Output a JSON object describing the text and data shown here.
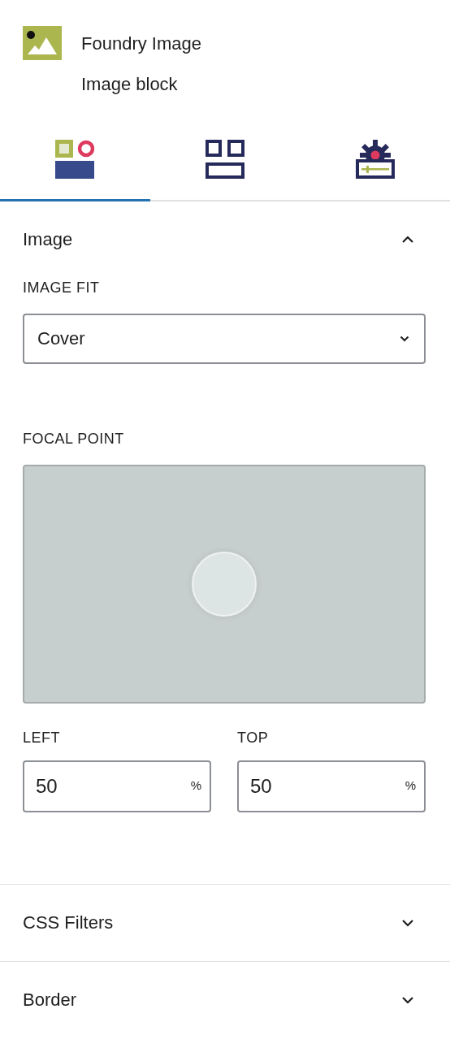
{
  "block": {
    "title": "Foundry Image",
    "subtitle": "Image block"
  },
  "tabs": [
    {
      "kind": "style",
      "selected": true
    },
    {
      "kind": "layout",
      "selected": false
    },
    {
      "kind": "settings",
      "selected": false
    }
  ],
  "panels": [
    {
      "title": "Image",
      "expanded": true,
      "image_fit": {
        "label": "IMAGE FIT",
        "value": "Cover"
      },
      "focal_point": {
        "label": "FOCAL POINT",
        "fields": [
          {
            "label": "LEFT",
            "value": "50",
            "unit": "%"
          },
          {
            "label": "TOP",
            "value": "50",
            "unit": "%"
          }
        ]
      }
    },
    {
      "title": "CSS Filters",
      "expanded": false
    },
    {
      "title": "Border",
      "expanded": false
    }
  ]
}
